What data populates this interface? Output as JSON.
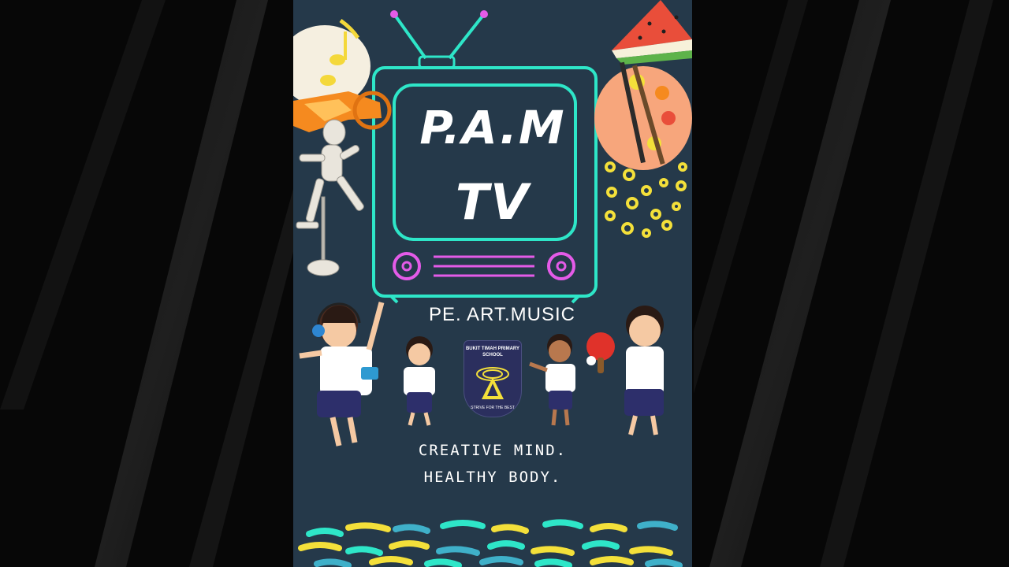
{
  "poster": {
    "title_line_1": "P.A.M",
    "title_line_2": "TV",
    "subtitle": "PE. ART.MUSIC",
    "tagline_1": "CREATIVE MIND.",
    "tagline_2": "HEALTHY BODY.",
    "school_badge": {
      "name": "BUKIT TIMAH PRIMARY SCHOOL",
      "motto": "STRIVE FOR THE BEST"
    }
  },
  "colors": {
    "poster_background": "#25394a",
    "neon_teal": "#2ee6c8",
    "neon_pink": "#e45be8",
    "accent_yellow": "#f4e03a",
    "page_background": "#070707"
  },
  "icons": [
    "music-note-icon",
    "trumpet-icon",
    "wooden-mannequin-icon",
    "watermelon-icon",
    "paint-palette-icon",
    "headphones-icon",
    "ping-pong-paddle-icon"
  ]
}
